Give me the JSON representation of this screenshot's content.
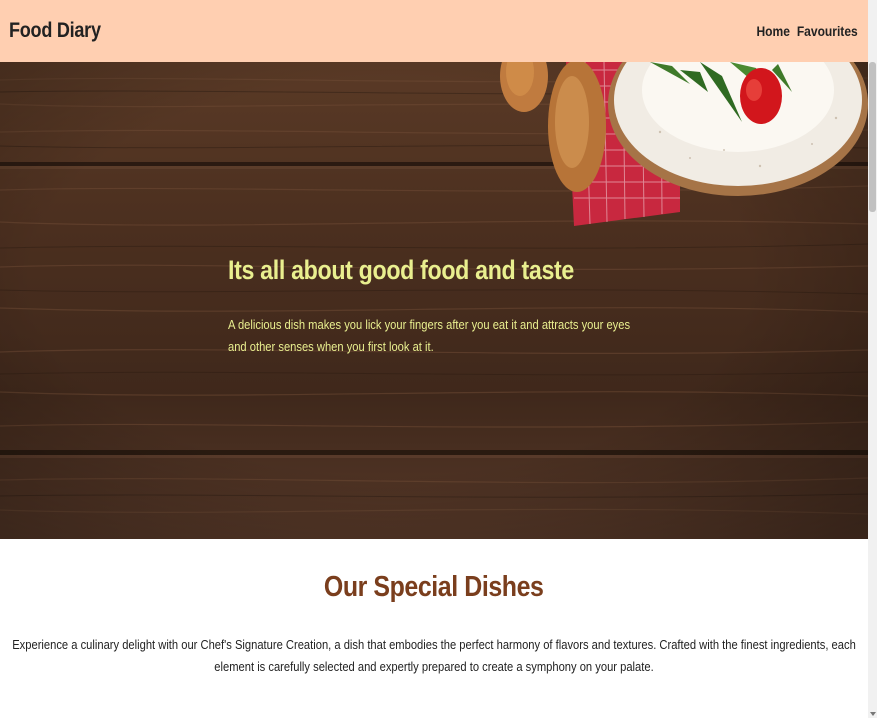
{
  "navbar": {
    "brand": "Food Diary",
    "links": [
      "Home",
      "Favourites"
    ]
  },
  "hero": {
    "title": "Its all about good food and taste",
    "text": "A delicious dish makes you lick your fingers after you eat it and attracts your eyes and other senses when you first look at it."
  },
  "special": {
    "title": "Our Special Dishes",
    "text": "Experience a culinary delight with our Chef's Signature Creation, a dish that embodies the perfect harmony of flavors and textures. Crafted with the finest ingredients, each element is carefully selected and expertly prepared to create a symphony on your palate."
  },
  "colors": {
    "navbar_bg": "#ffcfb1",
    "hero_text": "#e9ef8f",
    "section_title": "#7a3e1d"
  }
}
